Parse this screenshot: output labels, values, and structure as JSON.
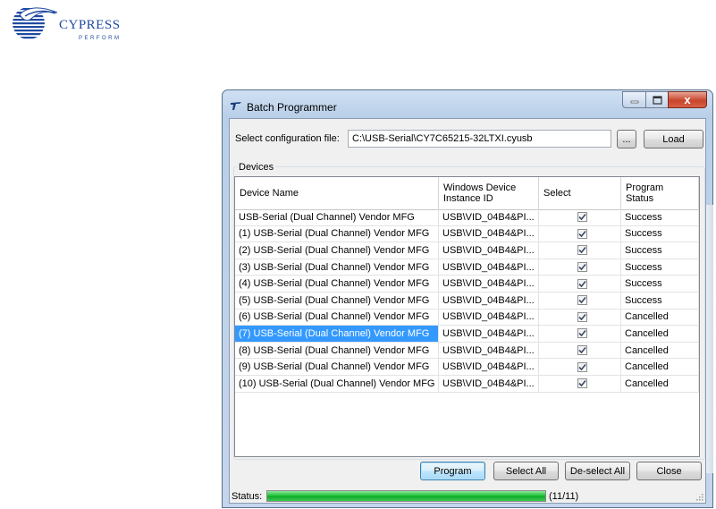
{
  "logo": {
    "word": "CYPRESS",
    "tagline": "PERFORM"
  },
  "window": {
    "title": "Batch Programmer",
    "icon": "rocket-icon",
    "controls": {
      "minimize_icon": "minimize-icon",
      "maximize_icon": "maximize-icon",
      "close_glyph": "x"
    }
  },
  "config": {
    "label": "Select configuration file:",
    "path": "C:\\USB-Serial\\CY7C65215-32LTXI.cyusb",
    "browse_label": "...",
    "load_label": "Load"
  },
  "devices": {
    "group_label": "Devices",
    "columns": [
      "Device Name",
      "Windows Device Instance ID",
      "Select",
      "Program Status"
    ],
    "rows": [
      {
        "name": "USB-Serial (Dual Channel) Vendor MFG",
        "instance": "USB\\VID_04B4&PI...",
        "checked": true,
        "status": "Success",
        "selected": false
      },
      {
        "name": "(1) USB-Serial (Dual Channel) Vendor MFG",
        "instance": "USB\\VID_04B4&PI...",
        "checked": true,
        "status": "Success",
        "selected": false
      },
      {
        "name": "(2) USB-Serial (Dual Channel) Vendor MFG",
        "instance": "USB\\VID_04B4&PI...",
        "checked": true,
        "status": "Success",
        "selected": false
      },
      {
        "name": "(3) USB-Serial (Dual Channel) Vendor MFG",
        "instance": "USB\\VID_04B4&PI...",
        "checked": true,
        "status": "Success",
        "selected": false
      },
      {
        "name": "(4) USB-Serial (Dual Channel) Vendor MFG",
        "instance": "USB\\VID_04B4&PI...",
        "checked": true,
        "status": "Success",
        "selected": false
      },
      {
        "name": "(5) USB-Serial (Dual Channel) Vendor MFG",
        "instance": "USB\\VID_04B4&PI...",
        "checked": true,
        "status": "Success",
        "selected": false
      },
      {
        "name": "(6) USB-Serial (Dual Channel) Vendor MFG",
        "instance": "USB\\VID_04B4&PI...",
        "checked": true,
        "status": "Cancelled",
        "selected": false
      },
      {
        "name": "(7) USB-Serial (Dual Channel) Vendor MFG",
        "instance": "USB\\VID_04B4&PI...",
        "checked": true,
        "status": "Cancelled",
        "selected": true
      },
      {
        "name": "(8) USB-Serial (Dual Channel) Vendor MFG",
        "instance": "USB\\VID_04B4&PI...",
        "checked": true,
        "status": "Cancelled",
        "selected": false
      },
      {
        "name": "(9) USB-Serial (Dual Channel) Vendor MFG",
        "instance": "USB\\VID_04B4&PI...",
        "checked": true,
        "status": "Cancelled",
        "selected": false
      },
      {
        "name": "(10) USB-Serial (Dual Channel) Vendor MFG",
        "instance": "USB\\VID_04B4&PI...",
        "checked": true,
        "status": "Cancelled",
        "selected": false
      }
    ]
  },
  "actions": {
    "program_label": "Program",
    "select_all_label": "Select All",
    "deselect_all_label": "De-select All",
    "close_label": "Close"
  },
  "status": {
    "label": "Status:",
    "progress_fraction": 1.0,
    "count": "(11/11)"
  },
  "colors": {
    "selection": "#3399ff",
    "progress": "#22c33b",
    "brand": "#1e4aa0"
  }
}
